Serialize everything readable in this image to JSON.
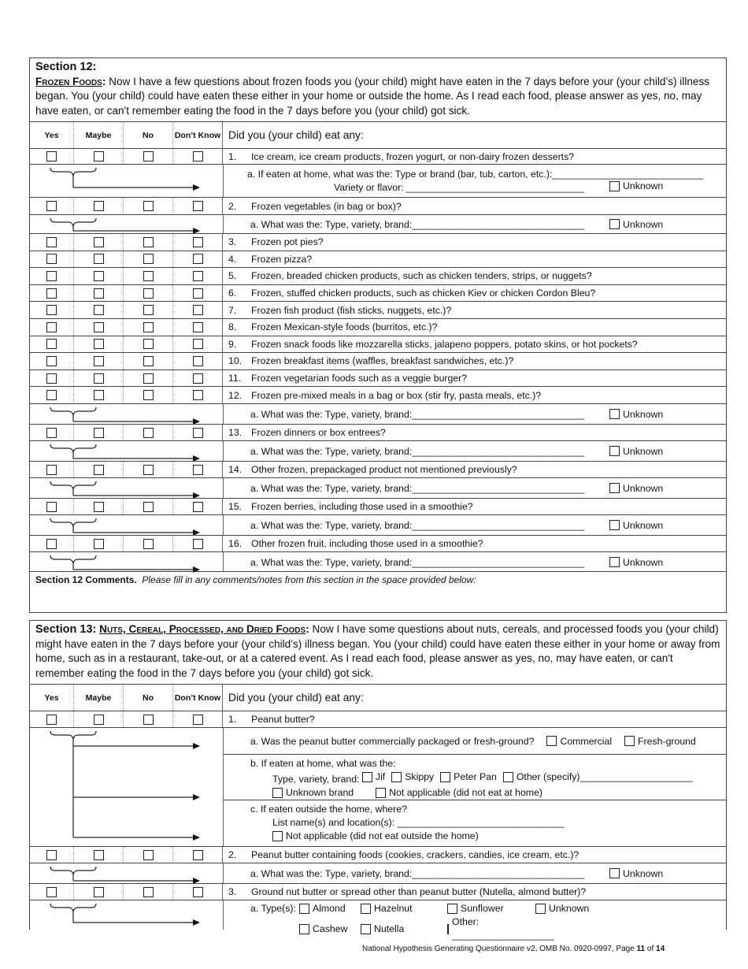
{
  "columns": [
    "Yes",
    "Maybe",
    "No",
    "Don’t Know"
  ],
  "question_header": "Did you (your child) eat any:",
  "unknown_label": "Unknown",
  "section12": {
    "title": "Section 12:",
    "heading": "Frozen Foods",
    "intro": "Now I have a few questions about frozen foods you (your child) might have eaten in the 7 days before your (your child’s) illness began.  You (your child) could have eaten these either in your home or outside the home. As I read each food, please answer as yes, no, may have eaten, or can't remember eating the food in the 7 days before you (your child) got sick.",
    "q1": {
      "num": "1.",
      "text": "Ice cream, ice cream products, frozen yogurt, or non-dairy frozen desserts?"
    },
    "q1a_line1": "a. If eaten at home, what was the: Type or brand (bar, tub, carton, etc.):____________________________",
    "q1a_line2": "Variety or flavor: _________________________________",
    "q2": {
      "num": "2.",
      "text": "Frozen vegetables (in bag or box)?"
    },
    "follow_up": "a. What was the: Type, variety, brand:________________________________",
    "list": [
      {
        "num": "3.",
        "text": "Frozen pot pies?"
      },
      {
        "num": "4.",
        "text": "Frozen pizza?"
      },
      {
        "num": "5.",
        "text": "Frozen, breaded chicken products, such as chicken tenders, strips, or nuggets?"
      },
      {
        "num": "6.",
        "text": "Frozen, stuffed chicken products, such as chicken Kiev or chicken Cordon Bleu?"
      },
      {
        "num": "7.",
        "text": "Frozen fish product (fish sticks, nuggets, etc.)?"
      },
      {
        "num": "8.",
        "text": "Frozen Mexican-style foods (burritos, etc.)?"
      },
      {
        "num": "9.",
        "text": "Frozen snack foods like mozzarella sticks, jalapeno poppers, potato skins, or hot pockets?"
      },
      {
        "num": "10.",
        "text": "Frozen breakfast items (waffles, breakfast sandwiches, etc.)?"
      },
      {
        "num": "11.",
        "text": "Frozen vegetarian foods such as a veggie burger?"
      },
      {
        "num": "12.",
        "text": "Frozen pre-mixed meals in a bag or box (stir fry, pasta meals, etc.)?"
      }
    ],
    "later": [
      {
        "num": "13.",
        "text": "Frozen dinners or box entrees?"
      },
      {
        "num": "14.",
        "text": "Other frozen, prepackaged product not mentioned previously?"
      },
      {
        "num": "15.",
        "text": "Frozen berries, including those used in a smoothie?"
      },
      {
        "num": "16.",
        "text": "Other frozen fruit, including those used in a smoothie?"
      }
    ],
    "comments_label": "Section 12 Comments.",
    "comments_hint": "Please fill in any comments/notes from this section in the space provided below:"
  },
  "section13": {
    "title": "Section 13:",
    "heading": "Nuts, Cereal, Processed, and Dried Foods",
    "intro": "Now I have some questions about nuts, cereals, and processed foods you (your child) might have eaten in the 7 days before your (your child’s) illness began.  You (your child) could have eaten these either in your home or away from home, such as in a restaurant, take-out, or at a catered event. As I read each food, please answer as yes, no, may have eaten, or can't remember eating the food in the 7 days before you (your child) got sick.",
    "q1": {
      "num": "1.",
      "text": "Peanut butter?"
    },
    "q1a": "a. Was the peanut butter commercially packaged or fresh-ground?",
    "q1a_opts": [
      "Commercial",
      "Fresh-ground"
    ],
    "q1b_title": "b. If eaten at home, what was the:",
    "q1b_label": "Type, variety, brand:",
    "q1b_opts": [
      "Jif",
      "Skippy",
      "Peter Pan",
      "Other (specify)_____________________"
    ],
    "q1b_opts2": [
      "Unknown brand",
      "Not applicable (did not eat at home)"
    ],
    "q1c_title": "c. If eaten outside the home, where?",
    "q1c_list": "List name(s) and location(s): _______________________________",
    "q1c_na": "Not applicable (did not eat outside the home)",
    "q2": {
      "num": "2.",
      "text": "Peanut butter containing foods (cookies, crackers, candies, ice cream, etc.)?"
    },
    "q3": {
      "num": "3.",
      "text": "Ground nut butter or spread other than peanut butter (Nutella, almond butter)?"
    },
    "q3a_label": "a. Type(s):",
    "q3a_opts": [
      "Almond",
      "Hazelnut",
      "Sunflower",
      "Unknown",
      "Cashew",
      "Nutella",
      "Other: ___________________"
    ]
  },
  "footer": {
    "text": "National Hypothesis Generating Questionnaire v2, OMB No. 0920-0997, Page ",
    "page": "11",
    "of": " of ",
    "total": "14"
  }
}
